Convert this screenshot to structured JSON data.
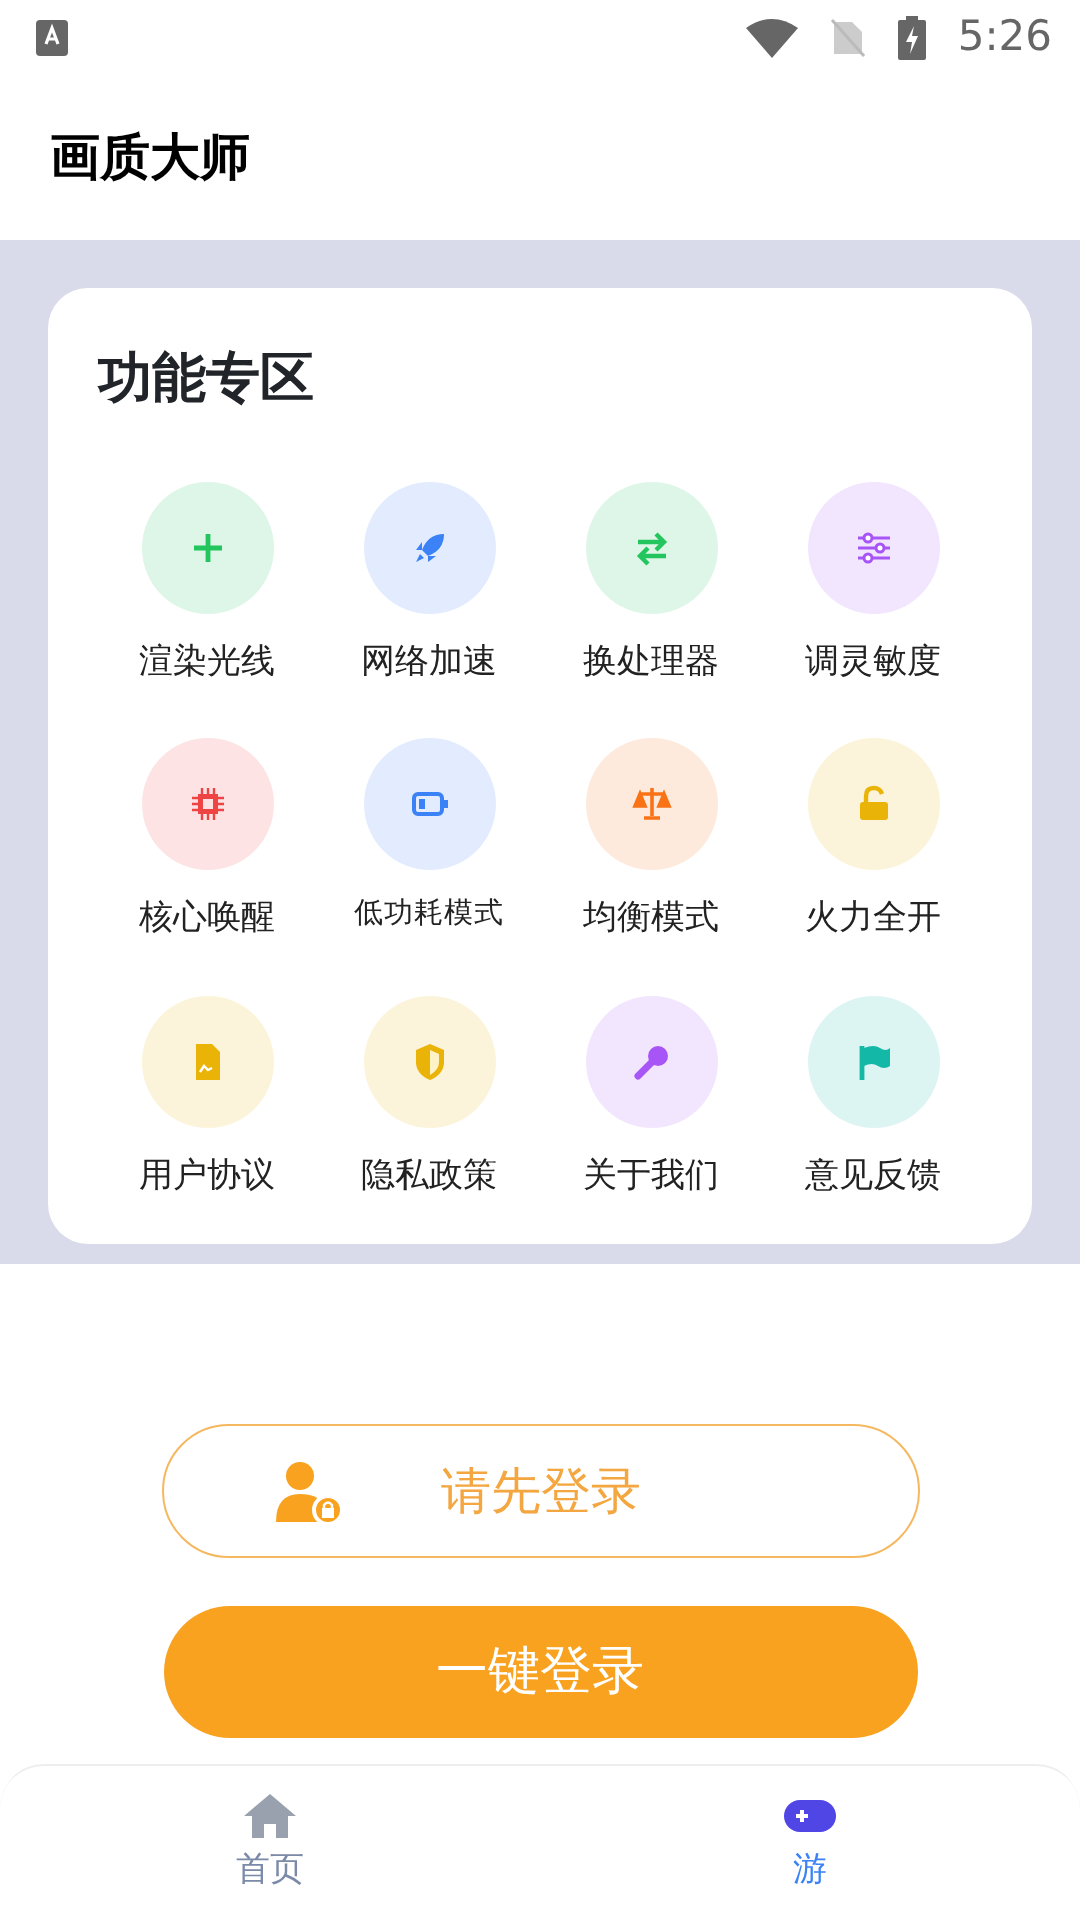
{
  "status_bar": {
    "time": "5:26"
  },
  "header": {
    "title": "画质大师"
  },
  "panel": {
    "title": "功能专区",
    "items": [
      {
        "label": "渲染光线",
        "color": "#22c55e"
      },
      {
        "label": "网络加速",
        "color": "#3b82f6"
      },
      {
        "label": "换处理器",
        "color": "#22c55e"
      },
      {
        "label": "调灵敏度",
        "color": "#a855f7"
      },
      {
        "label": "核心唤醒",
        "color": "#ef4444"
      },
      {
        "label": "低功耗模式",
        "color": "#3b82f6"
      },
      {
        "label": "均衡模式",
        "color": "#f97316"
      },
      {
        "label": "火力全开",
        "color": "#eab308"
      },
      {
        "label": "用户协议",
        "color": "#eab308"
      },
      {
        "label": "隐私政策",
        "color": "#eab308"
      },
      {
        "label": "关于我们",
        "color": "#a855f7"
      },
      {
        "label": "意见反馈",
        "color": "#14b8a6"
      }
    ]
  },
  "login_prompt": {
    "label": "请先登录"
  },
  "login_button": {
    "label": "一键登录"
  },
  "tabs": [
    {
      "label": "首页",
      "selected": false
    },
    {
      "label": "游",
      "selected": true
    }
  ]
}
